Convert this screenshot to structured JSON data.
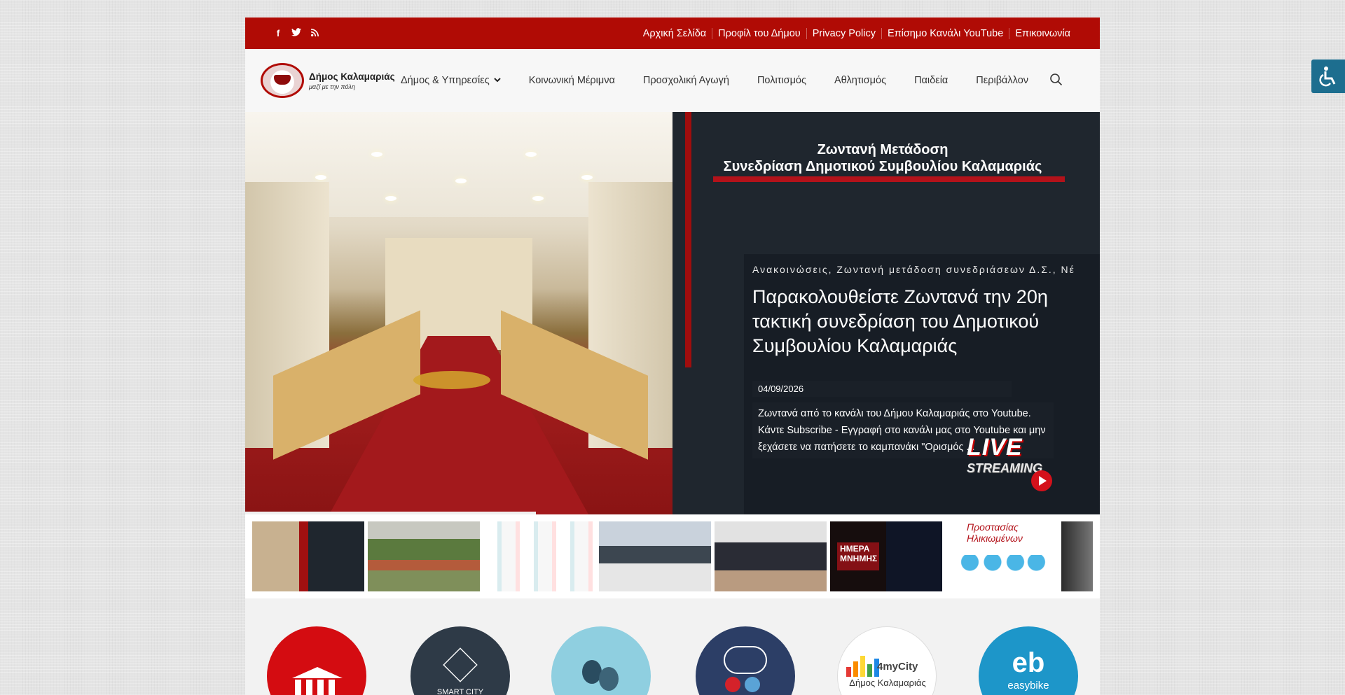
{
  "topbar": {
    "social": [
      {
        "icon": "facebook-icon",
        "glyph": "f"
      },
      {
        "icon": "twitter-icon",
        "glyph": "🐦"
      },
      {
        "icon": "rss-icon",
        "glyph": "◉"
      }
    ],
    "links": [
      "Αρχική Σελίδα",
      "Προφίλ του Δήμου",
      "Privacy Policy",
      "Επίσημο Κανάλι YouTube",
      "Επικοινωνία"
    ]
  },
  "header": {
    "logo_name": "Δήμος Καλαμαριάς",
    "logo_sub": "μαζί με την πόλη",
    "nav": [
      "Δήμος & Υπηρεσίες",
      "Κοινωνική Μέριμνα",
      "Προσχολική Αγωγή",
      "Πολιτισμός",
      "Αθλητισμός",
      "Παιδεία",
      "Περιβάλλον"
    ]
  },
  "hero": {
    "banner_line1": "Ζωντανή Μετάδοση",
    "banner_line2": "Συνεδρίαση Δημοτικού Συμβουλίου Καλαμαριάς",
    "categories": "Ανακοινώσεις, Ζωντανή μετάδοση συνεδριάσεων Δ.Σ., Νέ",
    "headline": "Παρακολουθείστε Ζωντανά την 20η τακτική συνεδρίαση του Δημοτικού Συμβουλίου Καλαμαριάς",
    "date": "04/09/2026",
    "excerpt": "Ζωντανά από το κανάλι του Δήμου Καλαμαριάς στο Youtube. Κάντε Subscribe - Εγγραφή στο κανάλι μας στο Youtube και μην ξεχάσετε να πατήσετε το καμπανάκι \"Ορισμός ...",
    "live_text": "LIVE",
    "streaming_text": "STREAMING",
    "slide_progress": 0.34
  },
  "thumbnails": {
    "t6_text": "ΗΜΕΡΑ ΜΝΗΜΗΣ",
    "t7_text": "Προστασίας Ηλικιωμένων"
  },
  "services": {
    "smart_city": "SMART CITY",
    "mycity_logo": "4myCity",
    "mycity_sub": "Δήμος Καλαμαριάς",
    "easybike": "easybike"
  },
  "colors": {
    "brand_red": "#b00b05",
    "hero_dark": "#1f262e",
    "accessibility": "#1d6e8f"
  }
}
